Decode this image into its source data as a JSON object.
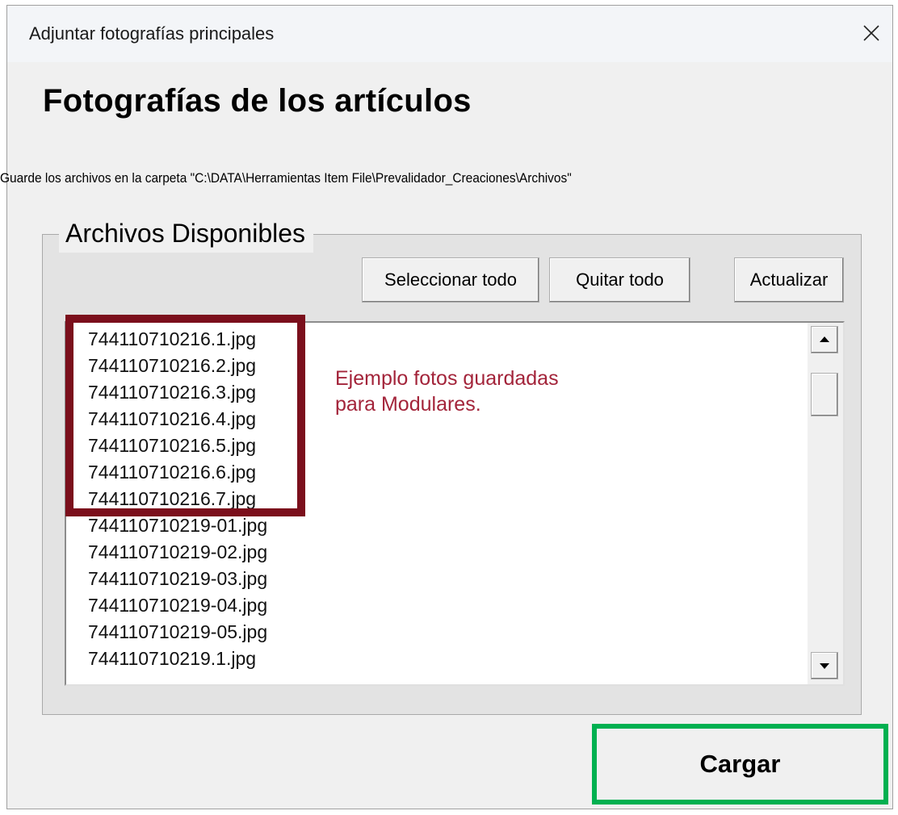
{
  "window": {
    "title": "Adjuntar fotografías principales",
    "close_icon": "close-icon"
  },
  "heading": "Fotografías de los artículos",
  "path_note": "Guarde los archivos en la carpeta \"C:\\DATA\\Herramientas Item File\\Prevalidador_Creaciones\\Archivos\"",
  "files_group": {
    "legend": "Archivos Disponibles",
    "buttons": {
      "select_all": "Seleccionar todo",
      "clear_all": "Quitar todo",
      "refresh": "Actualizar"
    },
    "files": [
      "744110710216.1.jpg",
      "744110710216.2.jpg",
      "744110710216.3.jpg",
      "744110710216.4.jpg",
      "744110710216.5.jpg",
      "744110710216.6.jpg",
      "744110710216.7.jpg",
      "744110710219-01.jpg",
      "744110710219-02.jpg",
      "744110710219-03.jpg",
      "744110710219-04.jpg",
      "744110710219-05.jpg",
      "744110710219.1.jpg"
    ],
    "scrollbar": {
      "up_icon": "scroll-up-arrow-icon",
      "down_icon": "scroll-down-arrow-icon"
    }
  },
  "annotation": {
    "line1": "Ejemplo fotos guardadas",
    "line2": "para Modulares.",
    "color": "#a3243a",
    "box_color": "#7b0f1c"
  },
  "load_button": {
    "label": "Cargar",
    "highlight_color": "#00b050"
  }
}
